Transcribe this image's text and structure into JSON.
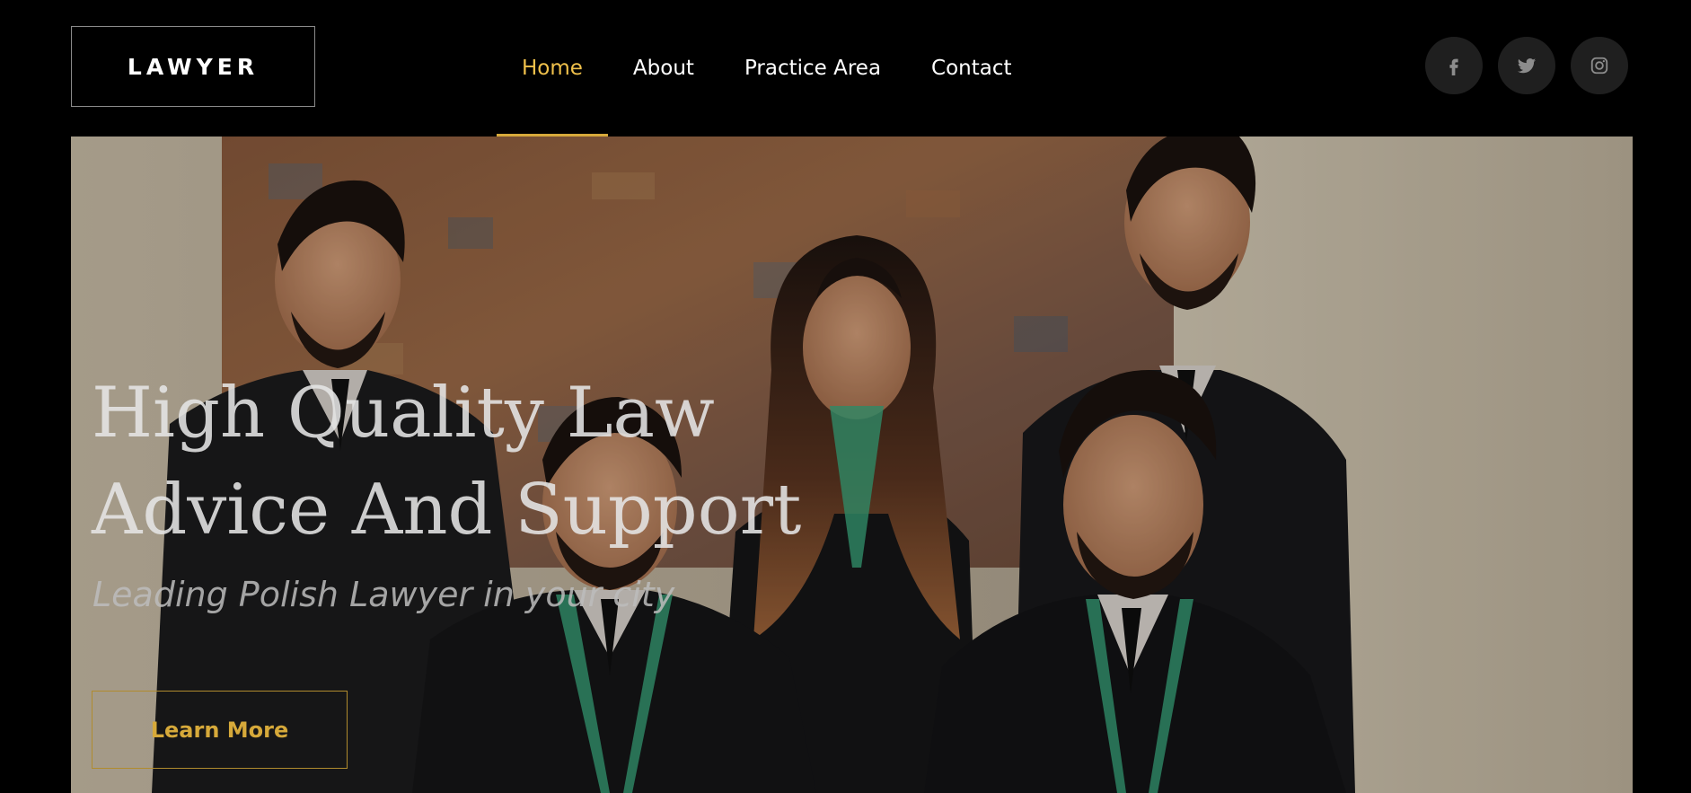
{
  "header": {
    "logo_text": "LAWYER",
    "nav": [
      {
        "label": "Home",
        "active": true
      },
      {
        "label": "About",
        "active": false
      },
      {
        "label": "Practice Area",
        "active": false
      },
      {
        "label": "Contact",
        "active": false
      }
    ],
    "social": [
      {
        "icon": "facebook-icon"
      },
      {
        "icon": "twitter-icon"
      },
      {
        "icon": "instagram-icon"
      }
    ]
  },
  "hero": {
    "title_line1": "High Quality Law",
    "title_line2": "Advice And Support",
    "subtitle": "Leading Polish Lawyer in your city",
    "button_label": "Learn More"
  },
  "colors": {
    "background": "#000000",
    "accent": "#f0c14b",
    "button_accent": "#d6a93a",
    "social_bg": "#1f1f1f"
  }
}
